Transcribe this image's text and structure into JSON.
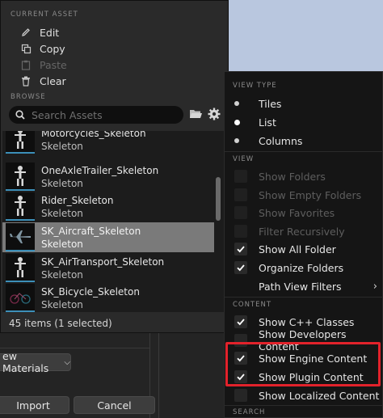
{
  "current_asset": {
    "section": "CURRENT ASSET",
    "items": [
      {
        "label": "Edit",
        "icon": "pencil-icon",
        "enabled": true
      },
      {
        "label": "Copy",
        "icon": "copy-icon",
        "enabled": true
      },
      {
        "label": "Paste",
        "icon": "paste-icon",
        "enabled": false
      },
      {
        "label": "Clear",
        "icon": "trash-icon",
        "enabled": true
      }
    ]
  },
  "browse": {
    "section": "BROWSE",
    "search_placeholder": "Search Assets",
    "assets": [
      {
        "name": "Motorcycles_Skeleton",
        "type": "Skeleton",
        "icon": "skeleton-icon",
        "selected": false
      },
      {
        "name": "OneAxleTrailer_Skeleton",
        "type": "Skeleton",
        "icon": "skeleton-icon",
        "selected": false
      },
      {
        "name": "Rider_Skeleton",
        "type": "Skeleton",
        "icon": "skeleton-icon",
        "selected": false
      },
      {
        "name": "SK_Aircraft_Skeleton",
        "type": "Skeleton",
        "icon": "aircraft-icon",
        "selected": true
      },
      {
        "name": "SK_AirTransport_Skeleton",
        "type": "Skeleton",
        "icon": "skeleton-icon",
        "selected": false
      },
      {
        "name": "SK_Bicycle_Skeleton",
        "type": "Skeleton",
        "icon": "bicycle-icon",
        "selected": false
      }
    ],
    "status": "45 items (1 selected)"
  },
  "lower": {
    "view_materials_label": "ew Materials",
    "import_label": "Import",
    "cancel_label": "Cancel"
  },
  "menu": {
    "view_type_section": "VIEW TYPE",
    "view_types": [
      {
        "label": "Tiles",
        "active": false
      },
      {
        "label": "List",
        "active": true
      },
      {
        "label": "Columns",
        "active": false
      }
    ],
    "view_section": "VIEW",
    "view_items": [
      {
        "label": "Show Folders",
        "checked": false,
        "enabled": false
      },
      {
        "label": "Show Empty Folders",
        "checked": false,
        "enabled": false
      },
      {
        "label": "Show Favorites",
        "checked": false,
        "enabled": false
      },
      {
        "label": "Filter Recursively",
        "checked": false,
        "enabled": false
      },
      {
        "label": "Show All Folder",
        "checked": true,
        "enabled": true
      },
      {
        "label": "Organize Folders",
        "checked": true,
        "enabled": true
      }
    ],
    "path_view_filters": "Path View Filters",
    "content_section": "CONTENT",
    "content_items": [
      {
        "label": "Show C++ Classes",
        "checked": true
      },
      {
        "label": "Show Developers Content",
        "checked": false
      },
      {
        "label": "Show Engine Content",
        "checked": true
      },
      {
        "label": "Show Plugin Content",
        "checked": true
      },
      {
        "label": "Show Localized Content",
        "checked": false
      }
    ],
    "search_section": "SEARCH"
  },
  "colors": {
    "highlight": "#e2222b",
    "selection": "#7a7a7a",
    "thumb_accent": "#3c8fb8"
  }
}
